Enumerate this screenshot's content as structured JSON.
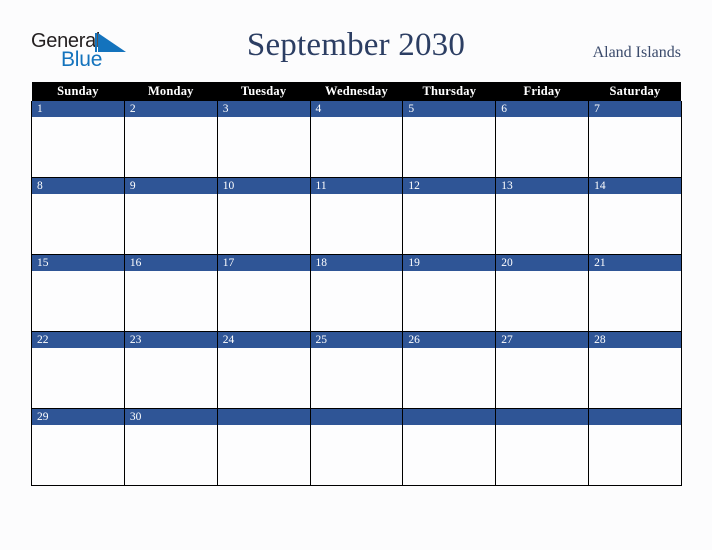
{
  "brand": {
    "name_top": "General",
    "name_bottom": "Blue",
    "logo_icon": "blue-triangle-icon",
    "color_top": "#231f20",
    "color_bottom": "#1473bd"
  },
  "header": {
    "title": "September 2030",
    "region": "Aland Islands",
    "title_color": "#2c3e63",
    "region_color": "#3a4a6b"
  },
  "calendar": {
    "weekday_headers": [
      "Sunday",
      "Monday",
      "Tuesday",
      "Wednesday",
      "Thursday",
      "Friday",
      "Saturday"
    ],
    "header_bg": "#000000",
    "header_fg": "#ffffff",
    "daynum_bg": "#2f5596",
    "daynum_fg": "#ffffff",
    "cell_bg": "#fdfdfe",
    "grid_line": "#000000",
    "weeks": [
      [
        {
          "day": "1"
        },
        {
          "day": "2"
        },
        {
          "day": "3"
        },
        {
          "day": "4"
        },
        {
          "day": "5"
        },
        {
          "day": "6"
        },
        {
          "day": "7"
        }
      ],
      [
        {
          "day": "8"
        },
        {
          "day": "9"
        },
        {
          "day": "10"
        },
        {
          "day": "11"
        },
        {
          "day": "12"
        },
        {
          "day": "13"
        },
        {
          "day": "14"
        }
      ],
      [
        {
          "day": "15"
        },
        {
          "day": "16"
        },
        {
          "day": "17"
        },
        {
          "day": "18"
        },
        {
          "day": "19"
        },
        {
          "day": "20"
        },
        {
          "day": "21"
        }
      ],
      [
        {
          "day": "22"
        },
        {
          "day": "23"
        },
        {
          "day": "24"
        },
        {
          "day": "25"
        },
        {
          "day": "26"
        },
        {
          "day": "27"
        },
        {
          "day": "28"
        }
      ],
      [
        {
          "day": "29"
        },
        {
          "day": "30"
        },
        {
          "day": ""
        },
        {
          "day": ""
        },
        {
          "day": ""
        },
        {
          "day": ""
        },
        {
          "day": ""
        }
      ]
    ]
  },
  "page": {
    "background": "#fcfcfd"
  }
}
